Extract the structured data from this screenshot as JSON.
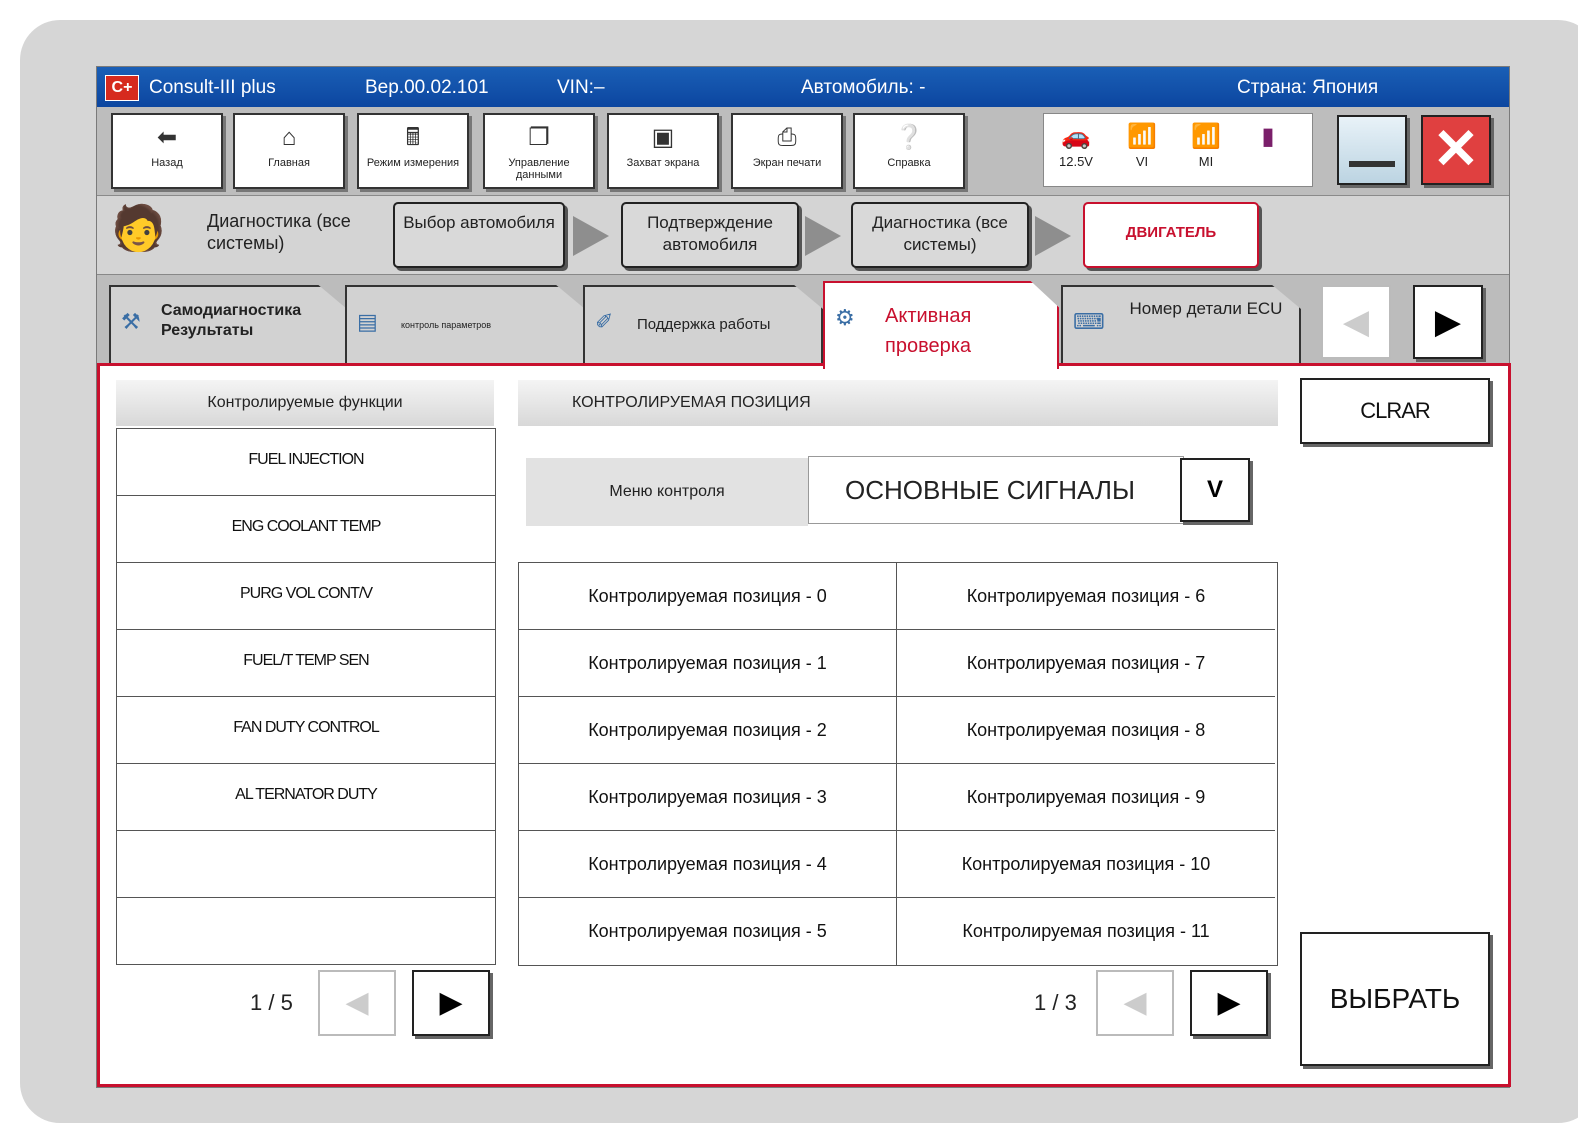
{
  "titlebar": {
    "logo": "C+",
    "app": "Consult-III plus",
    "version": "Вер.00.02.101",
    "vin": "VIN:–",
    "vehicle": "Автомобиль: -",
    "country": "Страна: Япония"
  },
  "toolbar": {
    "buttons": [
      {
        "label": "Назад",
        "icon": "back-arrow-icon"
      },
      {
        "label": "Главная",
        "icon": "home-icon"
      },
      {
        "label": "Режим измерения",
        "icon": "measure-icon"
      },
      {
        "label": "Управление данными",
        "icon": "data-management-icon"
      },
      {
        "label": "Захват экрана",
        "icon": "camera-icon"
      },
      {
        "label": "Экран печати",
        "icon": "printer-icon"
      },
      {
        "label": "Справка",
        "icon": "help-icon"
      }
    ],
    "status": {
      "battery": "12.5V",
      "vi": "VI",
      "mi": "MI"
    }
  },
  "breadcrumb": {
    "title": "Диагностика (все системы)",
    "steps": [
      "Выбор автомобиля",
      "Подтверждение автомобиля",
      "Диагностика (все системы)",
      "ДВИГАТЕЛЬ"
    ]
  },
  "tabs": [
    {
      "label": "Самодиагностика Результаты"
    },
    {
      "label": "контроль параметров"
    },
    {
      "label": "Поддержка работы"
    },
    {
      "label": "Активная проверка",
      "active": true
    },
    {
      "label": "Номер детали ECU"
    }
  ],
  "functions": {
    "header": "Контролируемые функции",
    "items": [
      "FUEL INJECTION",
      "ENG COOLANT TEMP",
      "PURG VOL CONT/V",
      "FUEL/T TEMP SEN",
      "FAN DUTY CONTROL",
      "AL TERNATOR DUTY",
      "",
      ""
    ],
    "page": "1 / 5"
  },
  "positions": {
    "header": "КОНТРОЛИРУЕМАЯ ПОЗИЦИЯ",
    "menu_label": "Меню контроля",
    "menu_value": "ОСНОВНЫЕ СИГНАЛЫ",
    "cells": [
      "Контролируемая позиция - 0",
      "Контролируемая позиция - 6",
      "Контролируемая позиция - 1",
      "Контролируемая позиция - 7",
      "Контролируемая позиция - 2",
      "Контролируемая позиция - 8",
      "Контролируемая позиция - 3",
      "Контролируемая позиция - 9",
      "Контролируемая позиция - 4",
      "Контролируемая позиция - 10",
      "Контролируемая позиция - 5",
      "Контролируемая позиция - 11"
    ],
    "page": "1 / 3"
  },
  "actions": {
    "clear": "CLRAR",
    "select": "ВЫБРАТЬ"
  },
  "colors": {
    "accent": "#c8102e",
    "titlebar": "#1a5fb6"
  }
}
